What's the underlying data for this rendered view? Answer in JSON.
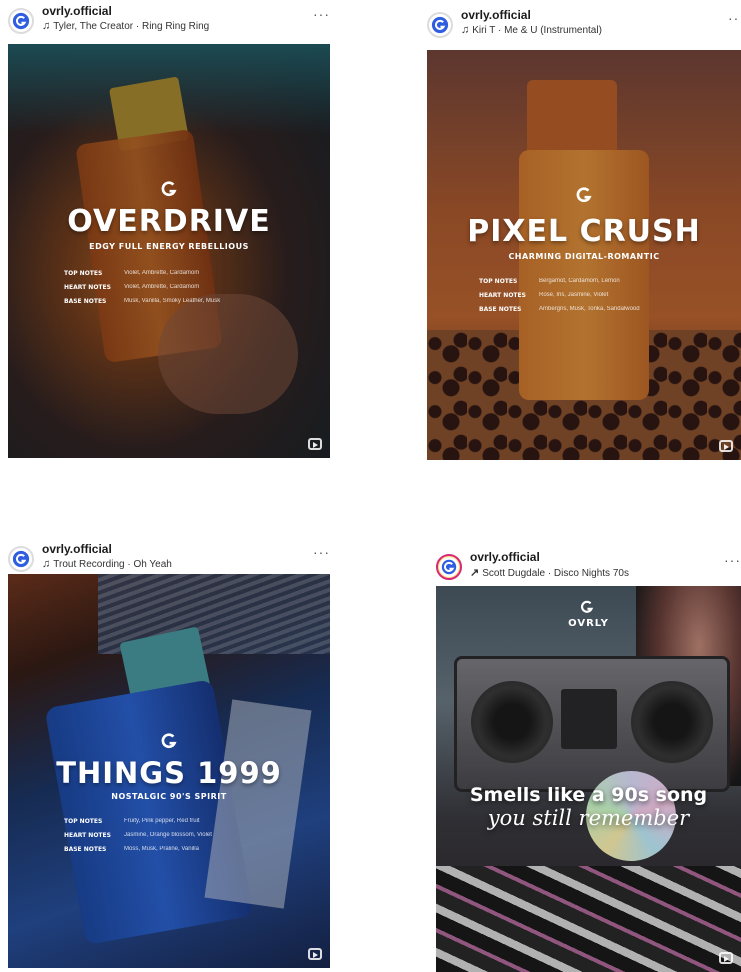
{
  "posts": [
    {
      "username": "ovrly.official",
      "audio": "Tyler, The Creator · Ring Ring Ring",
      "more": "···",
      "title": "OVERDRIVE",
      "subtitle": "EDGY FULL ENERGY REBELLIOUS",
      "notes": [
        {
          "label": "TOP NOTES",
          "value": "Violet, Ambrette, Cardamom"
        },
        {
          "label": "HEART NOTES",
          "value": "Violet, Ambrette, Cardamom"
        },
        {
          "label": "BASE NOTES",
          "value": "Musk, Vanilla, Smoky Leather, Musk"
        }
      ]
    },
    {
      "username": "ovrly.official",
      "audio": "Kiri T · Me & U (Instrumental)",
      "more": "···",
      "title": "PIXEL CRUSH",
      "subtitle": "CHARMING DIGITAL-ROMANTIC",
      "notes": [
        {
          "label": "TOP NOTES",
          "value": "Bergamot, Cardamom, Lemon"
        },
        {
          "label": "HEART NOTES",
          "value": "Rose, Iris, Jasmine, Violet"
        },
        {
          "label": "BASE NOTES",
          "value": "Ambergris, Musk, Tonka, Sandalwood"
        }
      ]
    },
    {
      "username": "ovrly.official",
      "audio": "Trout Recording · Oh Yeah",
      "more": "···",
      "title": "THINGS 1999",
      "subtitle": "NOSTALGIC 90'S SPIRIT",
      "notes": [
        {
          "label": "TOP NOTES",
          "value": "Fruity, Pink pepper, Red fruit"
        },
        {
          "label": "HEART NOTES",
          "value": "Jasmine, Orange blossom, Violet"
        },
        {
          "label": "BASE NOTES",
          "value": "Moss, Musk, Praline, Vanilla"
        }
      ]
    },
    {
      "username": "ovrly.official",
      "audio": "Scott Dugdale · Disco Nights 70s",
      "more": "···",
      "brand": "OVRLY",
      "tagline_line1": "Smells like a 90s song",
      "tagline_line2": "you still remember"
    }
  ],
  "colors": {
    "brand_blue": "#2f5fe0",
    "story_ring": "#d62976"
  },
  "icons": {
    "audio": "music-note-icon",
    "more": "more-options-icon",
    "reel": "reel-icon",
    "brand": "ovrly-logo-icon"
  }
}
